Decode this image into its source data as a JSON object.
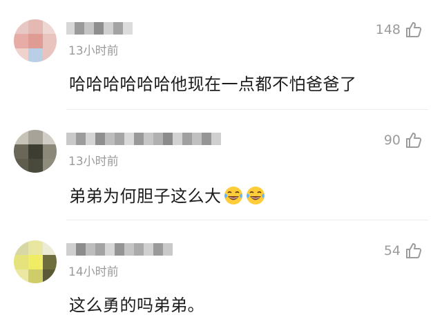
{
  "comments": [
    {
      "avatar": "avatar-pixelated-pink",
      "time": "13小时前",
      "text": "哈哈哈哈哈哈他现在一点都不怕爸爸了",
      "likes": "148",
      "like_icon": "thumbs-up-icon"
    },
    {
      "avatar": "avatar-pixelated-dark",
      "time": "13小时前",
      "text": "弟弟为何胆子这么大",
      "emojis": [
        "laughing-tears-emoji",
        "laughing-tears-emoji"
      ],
      "likes": "90",
      "like_icon": "thumbs-up-icon"
    },
    {
      "avatar": "avatar-pixelated-yellow",
      "time": "14小时前",
      "text": "这么勇的吗弟弟。",
      "likes": "54",
      "like_icon": "thumbs-up-icon"
    }
  ],
  "colors": {
    "secondary_text": "#9b9b9b",
    "primary_text": "#1c1c1c",
    "divider": "#ececec"
  }
}
